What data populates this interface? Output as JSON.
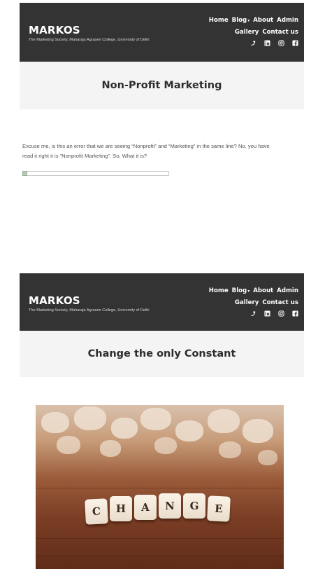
{
  "site": {
    "name": "MARKOS",
    "tagline": "The Marketing Society, Maharaja Agrasen College, University of Delhi"
  },
  "nav": {
    "row1": [
      "Home",
      "Blog",
      "About",
      "Admin"
    ],
    "row2": [
      "Gallery",
      "Contact us"
    ],
    "blog_caret": "▾"
  },
  "socials": [
    "twitter-icon",
    "linkedin-icon",
    "instagram-icon",
    "facebook-icon"
  ],
  "post1": {
    "title": "Non-Profit Marketing",
    "excerpt": "Excuse me, is this an error that we are seeing “Nonprofit” and “Marketing” in the same line? No, you have read it right it is “Nonprofit Marketing”. So, What it is?"
  },
  "post2": {
    "title": "Change the only Constant",
    "image_letters": [
      "C",
      "H",
      "A",
      "N",
      "G",
      "E"
    ]
  },
  "colors": {
    "header_bg": "#333333",
    "title_band_bg": "#f4f4f4"
  }
}
